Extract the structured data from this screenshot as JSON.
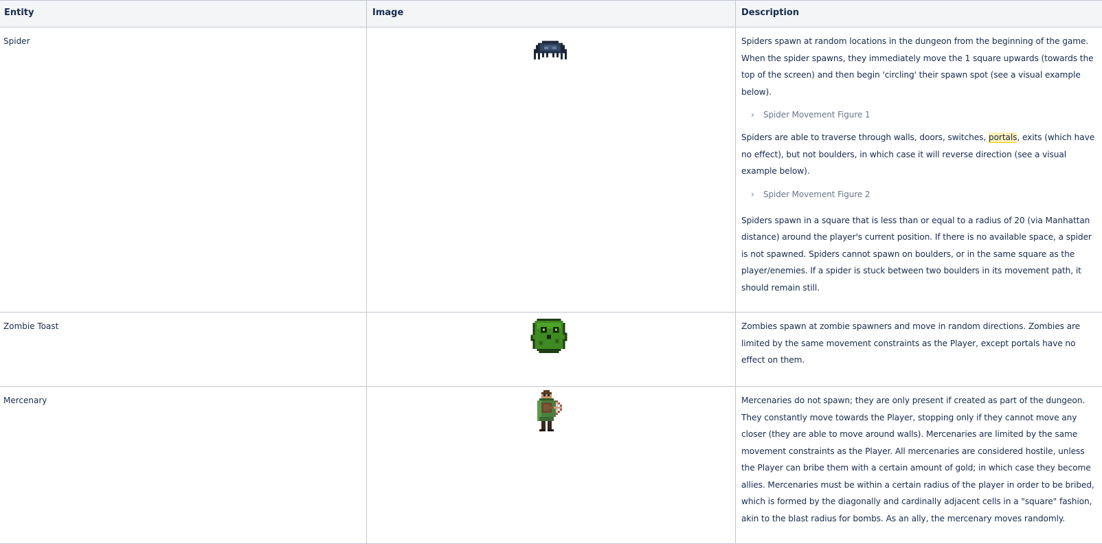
{
  "table": {
    "headers": {
      "entity": "Entity",
      "image": "Image",
      "description": "Description"
    },
    "rows": [
      {
        "entity": "Spider",
        "image_icon": "spider-sprite",
        "desc_p1": "Spiders spawn at random locations in the dungeon from the beginning of the game. When the spider spawns, they immediately move the 1 square upwards (towards the top of the screen) and then begin 'circling' their spawn spot (see a visual example below).",
        "expand1": "Spider Movement Figure 1",
        "desc_p2_a": "Spiders are able to traverse through walls, doors, switches, ",
        "desc_p2_link": "portals",
        "desc_p2_b": ", exits (which have no effect), but not boulders, in which case it will reverse direction (see a visual example below).",
        "expand2": "Spider Movement Figure 2",
        "desc_p3": "Spiders spawn in a square that is less than or equal to a radius of 20 (via Manhattan distance) around the player's current position. If there is no available space, a spider is not spawned. Spiders cannot spawn on boulders, or in the same square as the player/enemies. If a spider is stuck between two boulders in its movement path, it should remain still."
      },
      {
        "entity": "Zombie Toast",
        "image_icon": "zombie-toast-sprite",
        "desc_p1": "Zombies spawn at zombie spawners and move in random directions. Zombies are limited by the same movement constraints as the Player, except portals have no effect on them."
      },
      {
        "entity": "Mercenary",
        "image_icon": "mercenary-sprite",
        "desc_p1": "Mercenaries do not spawn; they are only present if created as part of the dungeon. They constantly move towards the Player, stopping only if they cannot move any closer (they are able to move around walls). Mercenaries are limited by the same movement constraints as the Player. All mercenaries are considered hostile, unless the Player can bribe them with a certain amount of gold; in which case they become allies. Mercenaries must be within a certain radius of the player in order to be bribed, which is formed by the diagonally and cardinally adjacent cells in a \"square\" fashion, akin to the blast radius for bombs. As an ally,  the mercenary moves randomly."
      }
    ]
  },
  "colors": {
    "border": "#c1c7d0",
    "header_bg": "#f4f5f7",
    "text": "#172b4d",
    "muted": "#6b778c",
    "highlight": "#fff0b3"
  }
}
